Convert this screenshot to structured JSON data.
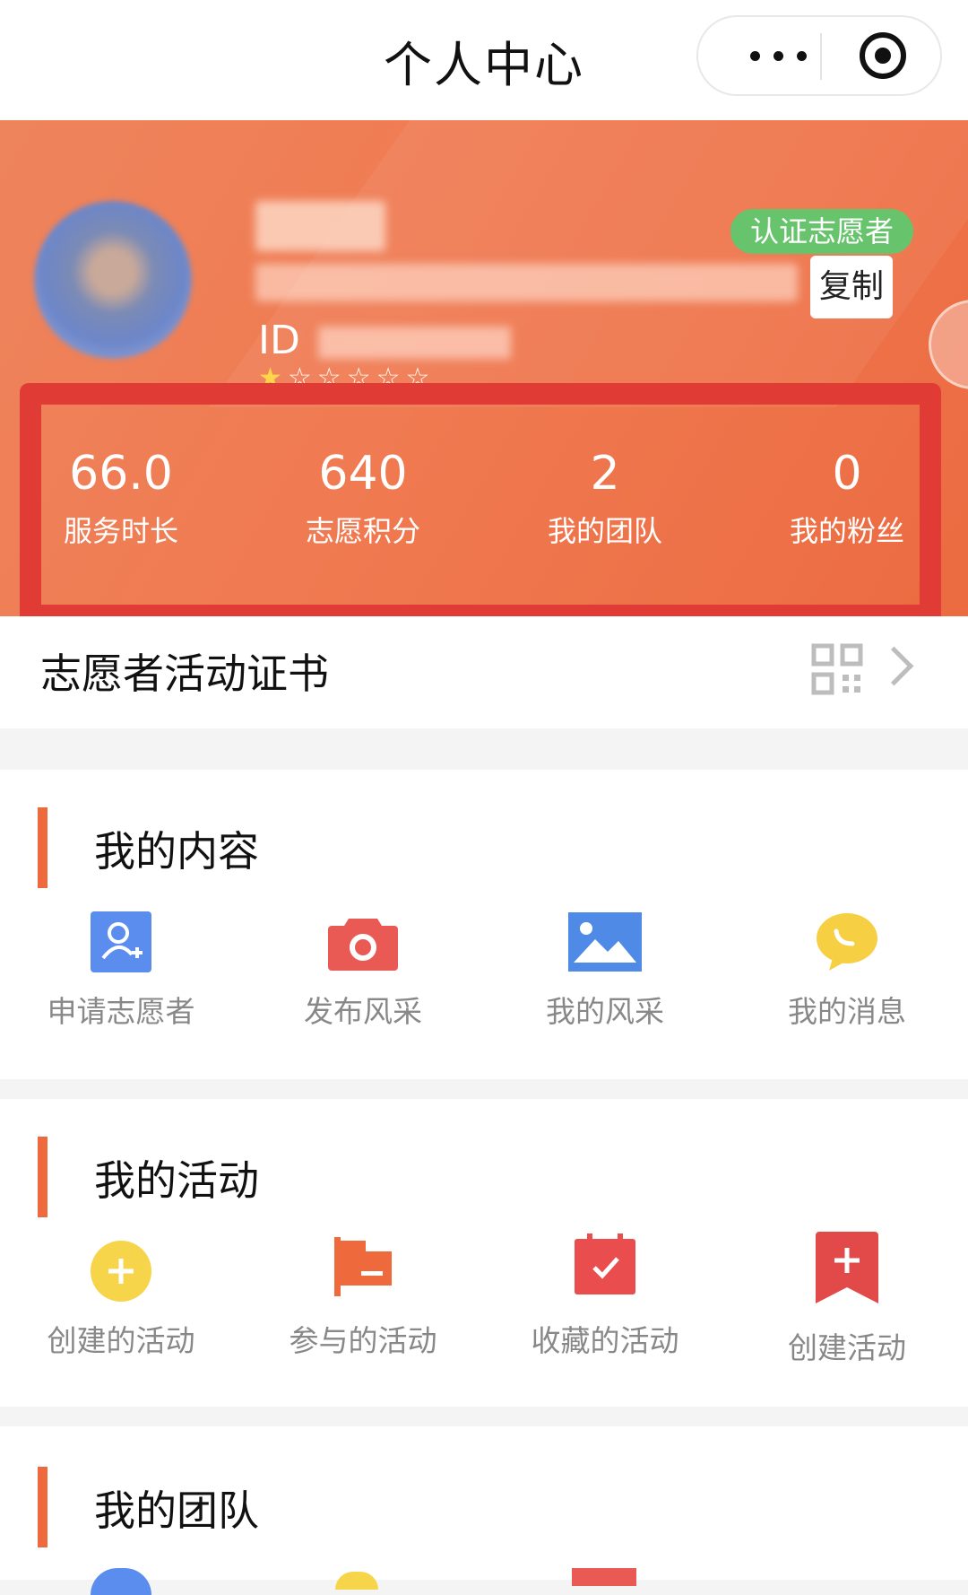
{
  "title_bar": {
    "title": "个人中心",
    "more_icon": "more-dots-icon",
    "capsule_close_icon": "target-icon"
  },
  "profile": {
    "badge": "认证志愿者",
    "copy_label": "复制",
    "id_prefix": "ID",
    "rating": {
      "filled": 1,
      "total": 6
    }
  },
  "stats": [
    {
      "value": "66.0",
      "label": "服务时长"
    },
    {
      "value": "640",
      "label": "志愿积分"
    },
    {
      "value": "2",
      "label": "我的团队"
    },
    {
      "value": "0",
      "label": "我的粉丝"
    }
  ],
  "certificate": {
    "title": "志愿者活动证书",
    "icon": "qr-code-icon",
    "arrow": "chevron-right-icon"
  },
  "my_content": {
    "title": "我的内容",
    "items": [
      {
        "label": "申请志愿者",
        "icon": "add-user-icon"
      },
      {
        "label": "发布风采",
        "icon": "camera-icon"
      },
      {
        "label": "我的风采",
        "icon": "image-icon"
      },
      {
        "label": "我的消息",
        "icon": "chat-bubble-icon"
      }
    ]
  },
  "my_activities": {
    "title": "我的活动",
    "items": [
      {
        "label": "创建的活动",
        "icon": "plus-circle-icon"
      },
      {
        "label": "参与的活动",
        "icon": "flag-icon"
      },
      {
        "label": "收藏的活动",
        "icon": "calendar-check-icon"
      },
      {
        "label": "创建活动",
        "icon": "bookmark-plus-icon"
      }
    ]
  },
  "my_team": {
    "title": "我的团队"
  },
  "colors": {
    "accent": "#ee6a3d",
    "highlight_border": "#e13b35",
    "badge_green": "#67c46c"
  }
}
